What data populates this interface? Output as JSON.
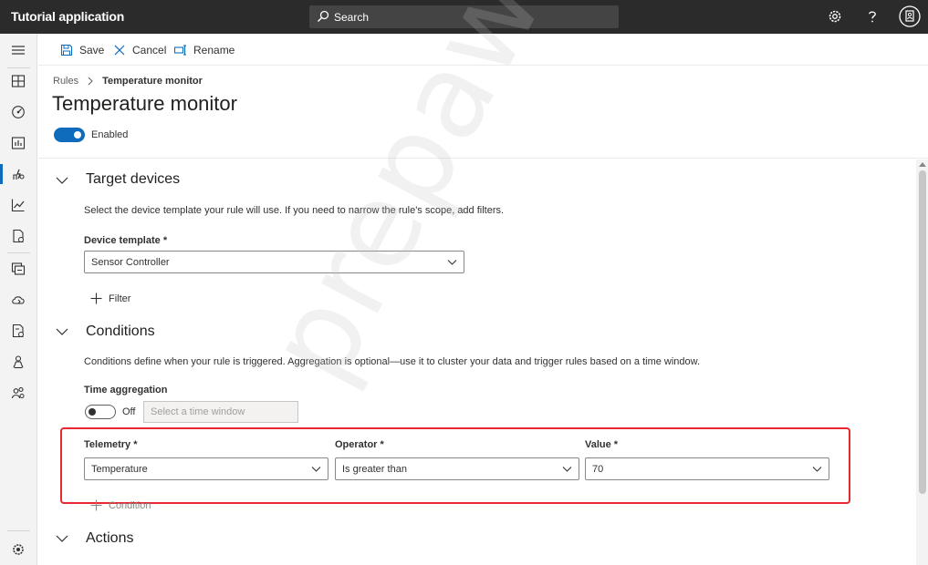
{
  "app": {
    "title": "Tutorial application"
  },
  "search": {
    "label": "Search"
  },
  "commands": {
    "save": "Save",
    "cancel": "Cancel",
    "rename": "Rename"
  },
  "breadcrumb": {
    "root": "Rules",
    "current": "Temperature monitor"
  },
  "page": {
    "title": "Temperature monitor",
    "enabled_label": "Enabled",
    "enabled": true
  },
  "target_devices": {
    "title": "Target devices",
    "description": "Select the device template your rule will use. If you need to narrow the rule's scope, add filters.",
    "template_label": "Device template *",
    "template_value": "Sensor Controller",
    "filter_label": "Filter"
  },
  "conditions": {
    "title": "Conditions",
    "description": "Conditions define when your rule is triggered. Aggregation is optional—use it to cluster your data and trigger rules based on a time window.",
    "time_aggregation_label": "Time aggregation",
    "time_aggregation_state": "Off",
    "time_window_placeholder": "Select a time window",
    "telemetry_label": "Telemetry *",
    "telemetry_value": "Temperature",
    "operator_label": "Operator *",
    "operator_value": "Is greater than",
    "value_label": "Value *",
    "value_value": "70",
    "add_condition_label": "Condition"
  },
  "actions": {
    "title": "Actions"
  },
  "watermark": "prepaway",
  "colors": {
    "accent": "#0f6cbd",
    "topbar": "#2b2b2b",
    "highlight": "#e8282f"
  },
  "nav_icons": [
    "hamburger-icon",
    "dashboard-icon",
    "devices-icon",
    "device-groups-icon",
    "rules-icon",
    "analytics-icon",
    "jobs-icon",
    "device-templates-icon",
    "data-export-icon",
    "device-connection-icon",
    "administration-icon",
    "users-icon",
    "settings-icon"
  ]
}
